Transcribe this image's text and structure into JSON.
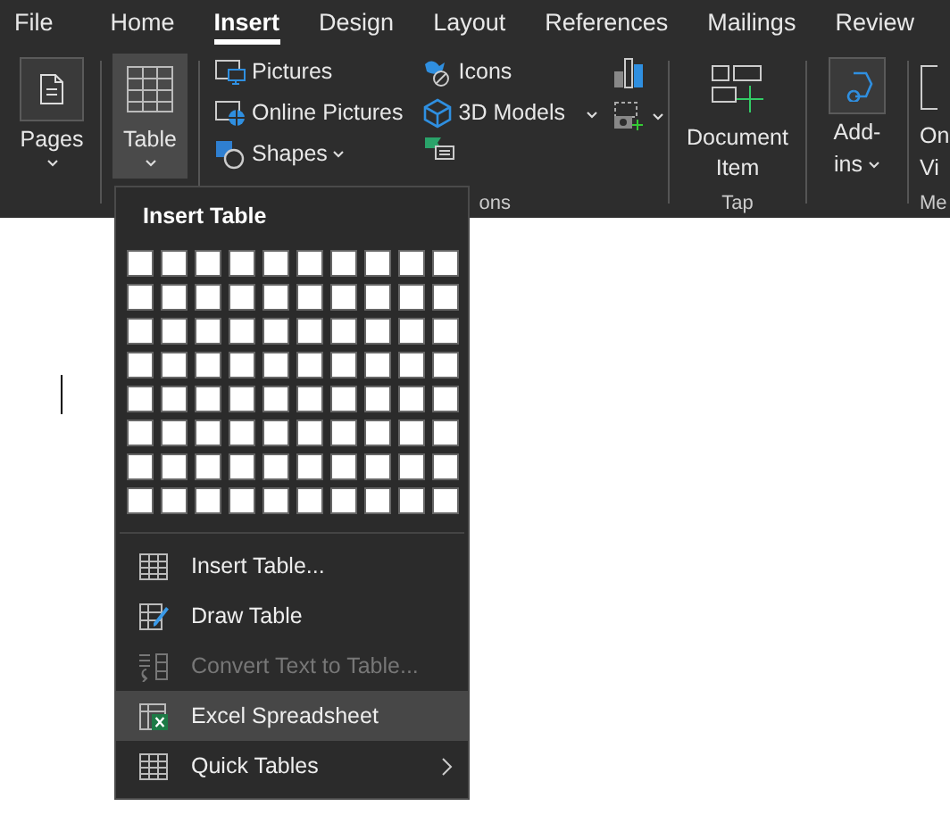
{
  "tabs": [
    {
      "label": "File",
      "selected": false
    },
    {
      "label": "Home",
      "selected": false
    },
    {
      "label": "Insert",
      "selected": true
    },
    {
      "label": "Design",
      "selected": false
    },
    {
      "label": "Layout",
      "selected": false
    },
    {
      "label": "References",
      "selected": false
    },
    {
      "label": "Mailings",
      "selected": false
    },
    {
      "label": "Review",
      "selected": false
    }
  ],
  "ribbon": {
    "pages": {
      "label": "Pages",
      "selected": false
    },
    "table": {
      "label": "Table",
      "selected": true
    },
    "illustrations": {
      "items": [
        {
          "label": "Pictures",
          "kind": "pictures"
        },
        {
          "label": "Online Pictures",
          "kind": "online"
        },
        {
          "label": "Shapes",
          "kind": "shapes"
        },
        {
          "label": "Icons",
          "kind": "icons"
        },
        {
          "label": "3D Models",
          "kind": "models"
        }
      ],
      "group_label": "ons"
    },
    "tap": {
      "label_lines": [
        "Document",
        "Item"
      ],
      "group_label": "Tap"
    },
    "addins": {
      "label_lines": [
        "Add-",
        "ins"
      ]
    },
    "media": {
      "label_lines": [
        "On",
        "Vi"
      ],
      "group_label": "Me"
    }
  },
  "menu": {
    "title": "Insert Table",
    "grid": [
      [
        {
          "selected": false
        },
        {
          "selected": false
        },
        {
          "selected": false
        },
        {
          "selected": false
        },
        {
          "selected": false
        },
        {
          "selected": false
        },
        {
          "selected": false
        },
        {
          "selected": false
        },
        {
          "selected": false
        },
        {
          "selected": false
        }
      ],
      [
        {
          "selected": false
        },
        {
          "selected": false
        },
        {
          "selected": false
        },
        {
          "selected": false
        },
        {
          "selected": false
        },
        {
          "selected": false
        },
        {
          "selected": false
        },
        {
          "selected": false
        },
        {
          "selected": false
        },
        {
          "selected": false
        }
      ],
      [
        {
          "selected": false
        },
        {
          "selected": false
        },
        {
          "selected": false
        },
        {
          "selected": false
        },
        {
          "selected": false
        },
        {
          "selected": false
        },
        {
          "selected": false
        },
        {
          "selected": false
        },
        {
          "selected": false
        },
        {
          "selected": false
        }
      ],
      [
        {
          "selected": false
        },
        {
          "selected": false
        },
        {
          "selected": false
        },
        {
          "selected": false
        },
        {
          "selected": false
        },
        {
          "selected": false
        },
        {
          "selected": false
        },
        {
          "selected": false
        },
        {
          "selected": false
        },
        {
          "selected": false
        }
      ],
      [
        {
          "selected": false
        },
        {
          "selected": false
        },
        {
          "selected": false
        },
        {
          "selected": false
        },
        {
          "selected": false
        },
        {
          "selected": false
        },
        {
          "selected": false
        },
        {
          "selected": false
        },
        {
          "selected": false
        },
        {
          "selected": false
        }
      ],
      [
        {
          "selected": false
        },
        {
          "selected": false
        },
        {
          "selected": false
        },
        {
          "selected": false
        },
        {
          "selected": false
        },
        {
          "selected": false
        },
        {
          "selected": false
        },
        {
          "selected": false
        },
        {
          "selected": false
        },
        {
          "selected": false
        }
      ],
      [
        {
          "selected": false
        },
        {
          "selected": false
        },
        {
          "selected": false
        },
        {
          "selected": false
        },
        {
          "selected": false
        },
        {
          "selected": false
        },
        {
          "selected": false
        },
        {
          "selected": false
        },
        {
          "selected": false
        },
        {
          "selected": false
        }
      ],
      [
        {
          "selected": false
        },
        {
          "selected": false
        },
        {
          "selected": false
        },
        {
          "selected": false
        },
        {
          "selected": false
        },
        {
          "selected": false
        },
        {
          "selected": false
        },
        {
          "selected": false
        },
        {
          "selected": false
        },
        {
          "selected": false
        }
      ]
    ],
    "items": [
      {
        "label": "Insert Table...",
        "kind": "table",
        "disabled": false,
        "selected": false,
        "submenu": false
      },
      {
        "label": "Draw Table",
        "kind": "draw",
        "disabled": false,
        "selected": false,
        "submenu": false
      },
      {
        "label": "Convert Text to Table...",
        "kind": "convert",
        "disabled": true,
        "selected": false,
        "submenu": false
      },
      {
        "label": "Excel Spreadsheet",
        "kind": "excel",
        "disabled": false,
        "selected": true,
        "submenu": false
      },
      {
        "label": "Quick Tables",
        "kind": "table",
        "disabled": false,
        "selected": false,
        "submenu": true
      }
    ]
  }
}
